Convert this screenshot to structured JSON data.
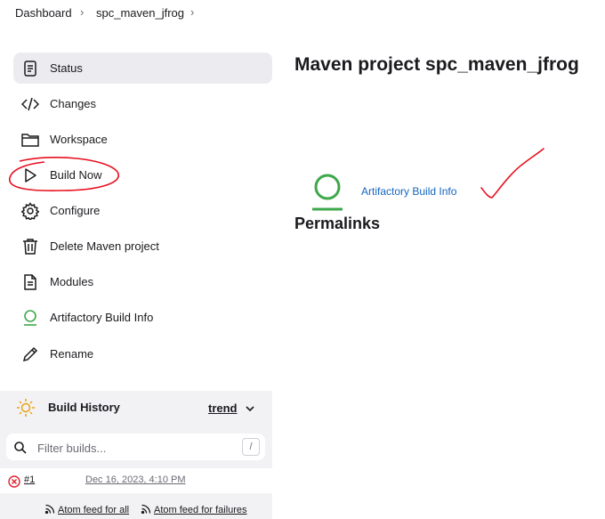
{
  "breadcrumb": {
    "items": [
      "Dashboard",
      "spc_maven_jfrog"
    ]
  },
  "sidebar": {
    "items": [
      {
        "label": "Status",
        "icon": "document-icon"
      },
      {
        "label": "Changes",
        "icon": "code-icon"
      },
      {
        "label": "Workspace",
        "icon": "folder-icon"
      },
      {
        "label": "Build Now",
        "icon": "play-icon"
      },
      {
        "label": "Configure",
        "icon": "gear-icon"
      },
      {
        "label": "Delete Maven project",
        "icon": "trash-icon"
      },
      {
        "label": "Modules",
        "icon": "file-icon"
      },
      {
        "label": "Artifactory Build Info",
        "icon": "artifactory-icon"
      },
      {
        "label": "Rename",
        "icon": "pencil-icon"
      }
    ]
  },
  "main": {
    "title": "Maven project spc_maven_jfrog",
    "artifactory_link": "Artifactory Build Info",
    "permalinks_heading": "Permalinks"
  },
  "build_history": {
    "title": "Build History",
    "trend_label": "trend",
    "filter_placeholder": "Filter builds...",
    "shortcut_key": "/",
    "builds": [
      {
        "number": "#1",
        "date": "Dec 16, 2023, 4:10 PM",
        "status": "failed"
      }
    ],
    "feeds": {
      "all": "Atom feed for all",
      "failures": "Atom feed for failures"
    }
  },
  "colors": {
    "accent": "#1565c0",
    "success": "#3ea84a",
    "failure": "#e0212e",
    "annotation": "#e8101f",
    "active_bg": "#ececf0"
  }
}
